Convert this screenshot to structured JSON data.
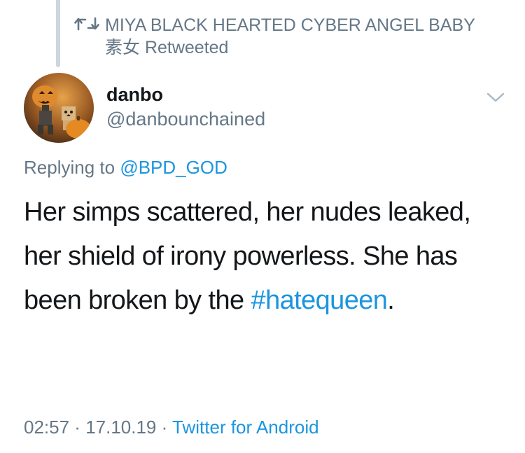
{
  "retweet": {
    "text": "MIYA BLACK HEARTED CYBER ANGEL BABY 素女 Retweeted"
  },
  "author": {
    "display_name": "danbo",
    "handle": "@danbounchained"
  },
  "reply": {
    "prefix": "Replying to",
    "target": "@BPD_GOD"
  },
  "tweet": {
    "text_main": "Her simps scattered, her nudes leaked, her shield of irony powerless. She has been broken by the",
    "hashtag": "#hatequeen",
    "text_end": "."
  },
  "meta": {
    "time": "02:57",
    "separator1": " · ",
    "date": "17.10.19",
    "separator2": " · ",
    "source": "Twitter for Android"
  },
  "colors": {
    "link": "#1b95e0",
    "muted": "#657786",
    "text": "#14171a"
  },
  "icons": {
    "retweet": "retweet-icon",
    "caret": "chevron-down-icon"
  }
}
